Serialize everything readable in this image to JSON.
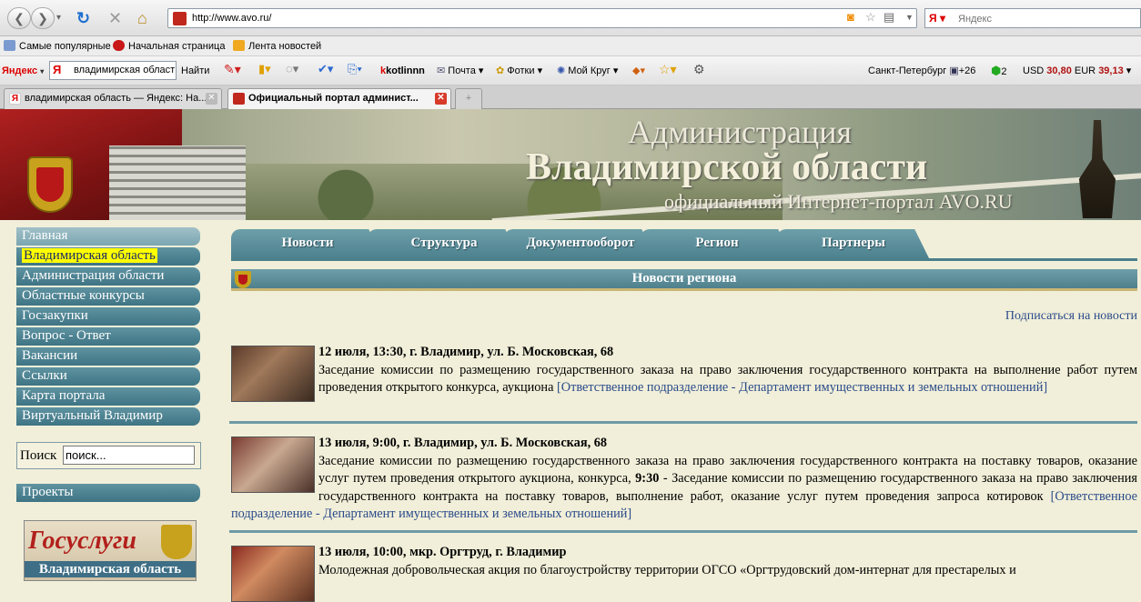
{
  "browser": {
    "url": "http://www.avo.ru/",
    "search_placeholder": "Яндекс",
    "bookmarks": [
      "Самые популярные",
      "Начальная страница",
      "Лента новостей"
    ],
    "yandex_bar": {
      "logo": "Яндекс",
      "query": "владимирская област",
      "find": "Найти",
      "kotlinnn": "kotlinnn",
      "mail": "Почта",
      "photos": "Фотки",
      "mykrug": "Мой Круг",
      "city": "Санкт-Петербург",
      "temp": "+26",
      "traffic": "2",
      "usd_label": "USD",
      "usd": "30,80",
      "eur_label": "EUR",
      "eur": "39,13"
    },
    "tabs": [
      {
        "label": "владимирская область — Яндекс: На..."
      },
      {
        "label": "Официальный портал админист..."
      }
    ]
  },
  "banner": {
    "line1": "Администрация",
    "line2": "Владимирской области",
    "line3": "официальный Интернет-портал AVO.RU"
  },
  "leftnav": {
    "items": [
      "Главная",
      "Владимирская область",
      "Администрация области",
      "Областные конкурсы",
      "Госзакупки",
      "Вопрос - Ответ",
      "Вакансии",
      "Ссылки",
      "Карта портала",
      "Виртуальный Владимир"
    ],
    "search_label": "Поиск",
    "search_value": "поиск...",
    "projects": "Проекты",
    "gosuslugi_title": "Госуслуги",
    "gosuslugi_sub": "Владимирская область"
  },
  "topmenu": [
    "Новости",
    "Структура",
    "Документооборот",
    "Регион",
    "Партнеры"
  ],
  "section_title": "Новости региона",
  "subscribe": "Подписаться на новости",
  "news": [
    {
      "head": "12 июля, 13:30, г. Владимир, ул. Б. Московская, 68",
      "text": "Заседание комиссии по размещению государственного заказа на право заключения государственного контракта на выполнение работ путем проведения открытого конкурса, аукциона",
      "dept": "[Ответственное подразделение -  Департамент имущественных и земельных отношений]"
    },
    {
      "head": "13 июля, 9:00, г. Владимир, ул. Б. Московская, 68",
      "text": "Заседание комиссии по размещению государственного заказа на право заключения государственного контракта на поставку товаров, оказание услуг путем проведения открытого аукциона, конкурса,",
      "time2": "9:30",
      "text2": "- Заседание комиссии по размещению государственного заказа на право заключения государственного контракта на поставку товаров, выполнение работ, оказание услуг путем проведения запроса котировок",
      "dept": "[Ответственное подразделение -  Департамент имущественных и земельных отношений]"
    },
    {
      "head": "13 июля, 10:00, мкр. Оргтруд, г. Владимир",
      "text": "Молодежная добровольческая акция по благоустройству территории ОГСО «Оргтрудовский дом-интернат для престарелых и"
    }
  ]
}
